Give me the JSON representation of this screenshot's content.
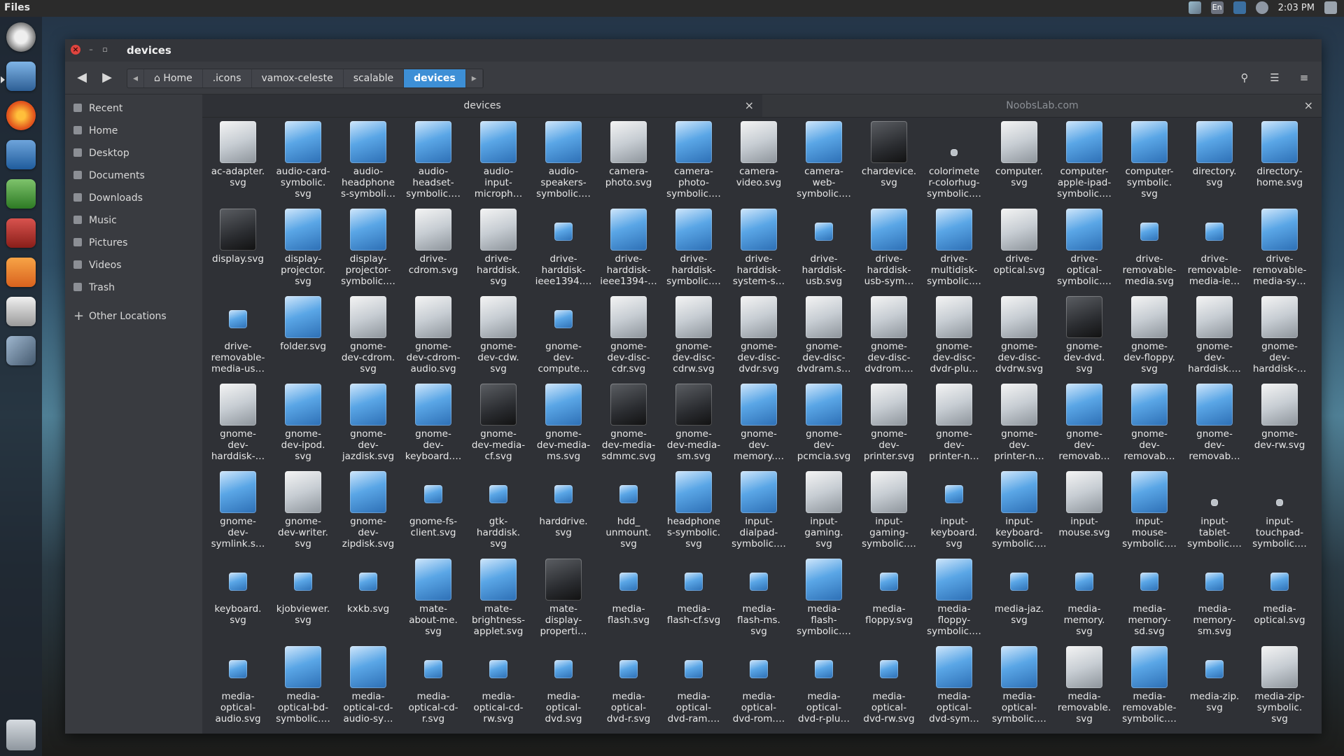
{
  "top_panel": {
    "app_title": "Files",
    "lang": "En",
    "clock": "2:03 PM"
  },
  "launcher": {
    "items": [
      "system-settings-icon",
      "files-icon",
      "firefox-icon",
      "libreoffice-writer-icon",
      "libreoffice-calc-icon",
      "libreoffice-impress-icon",
      "software-center-icon",
      "amazon-icon",
      "system-tools-icon"
    ],
    "trash": "trash-icon"
  },
  "window": {
    "title": "devices",
    "breadcrumb": [
      "Home",
      ".icons",
      "vamox-celeste",
      "scalable",
      "devices"
    ]
  },
  "sidebar": {
    "items": [
      "Recent",
      "Home",
      "Desktop",
      "Documents",
      "Downloads",
      "Music",
      "Pictures",
      "Videos",
      "Trash"
    ],
    "other": "Other Locations"
  },
  "tabs": {
    "active": "devices",
    "inactive": "NoobsLab.com"
  },
  "files": [
    [
      "ac-adapter.",
      "svg"
    ],
    [
      "audio-card-",
      "symbolic.",
      "svg"
    ],
    [
      "audio-",
      "headphone",
      "s-symboli…"
    ],
    [
      "audio-",
      "headset-",
      "symbolic.…"
    ],
    [
      "audio-",
      "input-",
      "microph…"
    ],
    [
      "audio-",
      "speakers-",
      "symbolic.…"
    ],
    [
      "camera-",
      "photo.svg"
    ],
    [
      "camera-",
      "photo-",
      "symbolic.…"
    ],
    [
      "camera-",
      "video.svg"
    ],
    [
      "camera-",
      "web-",
      "symbolic.…"
    ],
    [
      "chardevice.",
      "svg"
    ],
    [
      "colorimete",
      "r-colorhug-",
      "symbolic.…"
    ],
    [
      "computer.",
      "svg"
    ],
    [
      "computer-",
      "apple-ipad-",
      "symbolic.…"
    ],
    [
      "computer-",
      "symbolic.",
      "svg"
    ],
    [
      "directory.",
      "svg"
    ],
    [
      "directory-",
      "home.svg"
    ],
    [
      "display.svg"
    ],
    [
      "display-",
      "projector.",
      "svg"
    ],
    [
      "display-",
      "projector-",
      "symbolic.…"
    ],
    [
      "drive-",
      "cdrom.svg"
    ],
    [
      "drive-",
      "harddisk.",
      "svg"
    ],
    [
      "drive-",
      "harddisk-",
      "ieee1394.…"
    ],
    [
      "drive-",
      "harddisk-",
      "ieee1394-…"
    ],
    [
      "drive-",
      "harddisk-",
      "symbolic.…"
    ],
    [
      "drive-",
      "harddisk-",
      "system-s…"
    ],
    [
      "drive-",
      "harddisk-",
      "usb.svg"
    ],
    [
      "drive-",
      "harddisk-",
      "usb-sym…"
    ],
    [
      "drive-",
      "multidisk-",
      "symbolic.…"
    ],
    [
      "drive-",
      "optical.svg"
    ],
    [
      "drive-",
      "optical-",
      "symbolic.…"
    ],
    [
      "drive-",
      "removable-",
      "media.svg"
    ],
    [
      "drive-",
      "removable-",
      "media-ie…"
    ],
    [
      "drive-",
      "removable-",
      "media-sy…"
    ],
    [
      "drive-",
      "removable-",
      "media-us…"
    ],
    [
      "folder.svg"
    ],
    [
      "gnome-",
      "dev-cdrom.",
      "svg"
    ],
    [
      "gnome-",
      "dev-cdrom-",
      "audio.svg"
    ],
    [
      "gnome-",
      "dev-cdw.",
      "svg"
    ],
    [
      "gnome-",
      "dev-",
      "compute…"
    ],
    [
      "gnome-",
      "dev-disc-",
      "cdr.svg"
    ],
    [
      "gnome-",
      "dev-disc-",
      "cdrw.svg"
    ],
    [
      "gnome-",
      "dev-disc-",
      "dvdr.svg"
    ],
    [
      "gnome-",
      "dev-disc-",
      "dvdram.s…"
    ],
    [
      "gnome-",
      "dev-disc-",
      "dvdrom.…"
    ],
    [
      "gnome-",
      "dev-disc-",
      "dvdr-plu…"
    ],
    [
      "gnome-",
      "dev-disc-",
      "dvdrw.svg"
    ],
    [
      "gnome-",
      "dev-dvd.",
      "svg"
    ],
    [
      "gnome-",
      "dev-floppy.",
      "svg"
    ],
    [
      "gnome-",
      "dev-",
      "harddisk.…"
    ],
    [
      "gnome-",
      "dev-",
      "harddisk-…"
    ],
    [
      "gnome-",
      "dev-",
      "harddisk-…"
    ],
    [
      "gnome-",
      "dev-ipod.",
      "svg"
    ],
    [
      "gnome-",
      "dev-",
      "jazdisk.svg"
    ],
    [
      "gnome-",
      "dev-",
      "keyboard.…"
    ],
    [
      "gnome-",
      "dev-media-",
      "cf.svg"
    ],
    [
      "gnome-",
      "dev-media-",
      "ms.svg"
    ],
    [
      "gnome-",
      "dev-media-",
      "sdmmc.svg"
    ],
    [
      "gnome-",
      "dev-media-",
      "sm.svg"
    ],
    [
      "gnome-",
      "dev-",
      "memory.…"
    ],
    [
      "gnome-",
      "dev-",
      "pcmcia.svg"
    ],
    [
      "gnome-",
      "dev-",
      "printer.svg"
    ],
    [
      "gnome-",
      "dev-",
      "printer-n…"
    ],
    [
      "gnome-",
      "dev-",
      "printer-n…"
    ],
    [
      "gnome-",
      "dev-",
      "removab…"
    ],
    [
      "gnome-",
      "dev-",
      "removab…"
    ],
    [
      "gnome-",
      "dev-",
      "removab…"
    ],
    [
      "gnome-",
      "dev-rw.svg"
    ],
    [
      "gnome-",
      "dev-",
      "symlink.s…"
    ],
    [
      "gnome-",
      "dev-writer.",
      "svg"
    ],
    [
      "gnome-",
      "dev-",
      "zipdisk.svg"
    ],
    [
      "gnome-fs-",
      "client.svg"
    ],
    [
      "gtk-",
      "harddisk.",
      "svg"
    ],
    [
      "harddrive.",
      "svg"
    ],
    [
      "hdd_",
      "unmount.",
      "svg"
    ],
    [
      "headphone",
      "s-symbolic.",
      "svg"
    ],
    [
      "input-",
      "dialpad-",
      "symbolic.…"
    ],
    [
      "input-",
      "gaming.",
      "svg"
    ],
    [
      "input-",
      "gaming-",
      "symbolic.…"
    ],
    [
      "input-",
      "keyboard.",
      "svg"
    ],
    [
      "input-",
      "keyboard-",
      "symbolic.…"
    ],
    [
      "input-",
      "mouse.svg"
    ],
    [
      "input-",
      "mouse-",
      "symbolic.…"
    ],
    [
      "input-",
      "tablet-",
      "symbolic.…"
    ],
    [
      "input-",
      "touchpad-",
      "symbolic.…"
    ],
    [
      "keyboard.",
      "svg"
    ],
    [
      "kjobviewer.",
      "svg"
    ],
    [
      "kxkb.svg"
    ],
    [
      "mate-",
      "about-me.",
      "svg"
    ],
    [
      "mate-",
      "brightness-",
      "applet.svg"
    ],
    [
      "mate-",
      "display-",
      "properti…"
    ],
    [
      "media-",
      "flash.svg"
    ],
    [
      "media-",
      "flash-cf.svg"
    ],
    [
      "media-",
      "flash-ms.",
      "svg"
    ],
    [
      "media-",
      "flash-",
      "symbolic.…"
    ],
    [
      "media-",
      "floppy.svg"
    ],
    [
      "media-",
      "floppy-",
      "symbolic.…"
    ],
    [
      "media-jaz.",
      "svg"
    ],
    [
      "media-",
      "memory.",
      "svg"
    ],
    [
      "media-",
      "memory-",
      "sd.svg"
    ],
    [
      "media-",
      "memory-",
      "sm.svg"
    ],
    [
      "media-",
      "optical.svg"
    ],
    [
      "media-",
      "optical-",
      "audio.svg"
    ],
    [
      "media-",
      "optical-bd-",
      "symbolic.…"
    ],
    [
      "media-",
      "optical-cd-",
      "audio-sy…"
    ],
    [
      "media-",
      "optical-cd-",
      "r.svg"
    ],
    [
      "media-",
      "optical-cd-",
      "rw.svg"
    ],
    [
      "media-",
      "optical-",
      "dvd.svg"
    ],
    [
      "media-",
      "optical-",
      "dvd-r.svg"
    ],
    [
      "media-",
      "optical-",
      "dvd-ram.…"
    ],
    [
      "media-",
      "optical-",
      "dvd-rom.…"
    ],
    [
      "media-",
      "optical-",
      "dvd-r-plu…"
    ],
    [
      "media-",
      "optical-",
      "dvd-rw.svg"
    ],
    [
      "media-",
      "optical-",
      "dvd-sym…"
    ],
    [
      "media-",
      "optical-",
      "symbolic.…"
    ],
    [
      "media-",
      "removable.",
      "svg"
    ],
    [
      "media-",
      "removable-",
      "symbolic.…"
    ],
    [
      "media-zip.",
      "svg"
    ],
    [
      "media-zip-",
      "symbolic.",
      "svg"
    ]
  ],
  "icon_styles": [
    "gray",
    "blue",
    "blue",
    "blue",
    "blue",
    "blue",
    "gray",
    "blue",
    "gray",
    "blue",
    "dark",
    "tiny",
    "gray",
    "blue",
    "blue",
    "blue",
    "blue",
    "dark",
    "blue",
    "blue",
    "gray",
    "gray",
    "small",
    "blue",
    "blue",
    "blue",
    "small",
    "blue",
    "blue",
    "gray",
    "blue",
    "small",
    "small",
    "blue",
    "small",
    "blue",
    "gray",
    "gray",
    "gray",
    "small",
    "gray",
    "gray",
    "gray",
    "gray",
    "gray",
    "gray",
    "gray",
    "dark",
    "gray",
    "gray",
    "gray",
    "gray",
    "blue",
    "blue",
    "blue",
    "dark",
    "blue",
    "dark",
    "dark",
    "blue",
    "blue",
    "gray",
    "gray",
    "gray",
    "blue",
    "blue",
    "blue",
    "gray",
    "blue",
    "gray",
    "blue",
    "small",
    "small",
    "small",
    "small",
    "blue",
    "blue",
    "gray",
    "gray",
    "small",
    "blue",
    "gray",
    "blue",
    "tiny",
    "tiny",
    "small",
    "small",
    "small",
    "blue",
    "blue",
    "dark",
    "small",
    "small",
    "small",
    "blue",
    "small",
    "blue",
    "small",
    "small",
    "small",
    "small",
    "small",
    "small",
    "blue",
    "blue",
    "small",
    "small",
    "small",
    "small",
    "small",
    "small",
    "small",
    "small",
    "blue",
    "blue",
    "gray",
    "blue",
    "small",
    "gray"
  ]
}
